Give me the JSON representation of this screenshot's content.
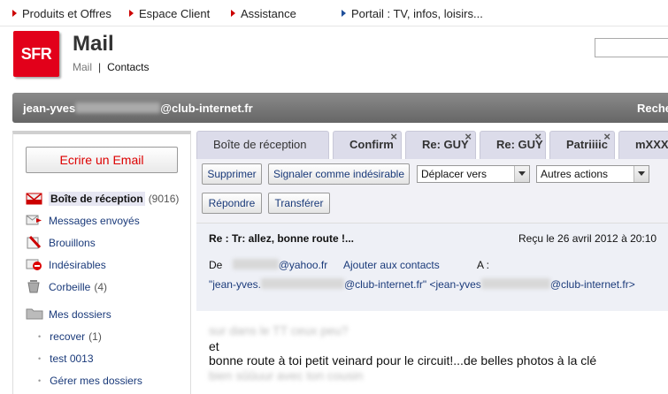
{
  "topnav": {
    "items": [
      {
        "label": "Produits et Offres"
      },
      {
        "label": "Espace Client"
      },
      {
        "label": "Assistance"
      },
      {
        "label": "Portail : TV, infos, loisirs..."
      }
    ]
  },
  "header": {
    "logo_text": "SFR",
    "title": "Mail",
    "sub_mail": "Mail",
    "sub_sep": "|",
    "sub_contacts": "Contacts"
  },
  "account": {
    "email_prefix": "jean-yves",
    "email_domain": "@club-internet.fr",
    "search_label": "Reche"
  },
  "sidebar": {
    "compose_label": "Ecrire un Email",
    "folders": [
      {
        "label": "Boîte de réception",
        "count": "(9016)",
        "icon": "inbox-icon"
      },
      {
        "label": "Messages envoyés",
        "count": "",
        "icon": "sent-icon"
      },
      {
        "label": "Brouillons",
        "count": "",
        "icon": "drafts-icon"
      },
      {
        "label": "Indésirables",
        "count": "",
        "icon": "spam-icon"
      },
      {
        "label": "Corbeille",
        "count": "(4)",
        "icon": "trash-icon"
      },
      {
        "label": "Mes dossiers",
        "count": "",
        "icon": "folder-icon"
      }
    ],
    "subfolders": [
      {
        "label": "recover",
        "count": "(1)"
      },
      {
        "label": "test 0013",
        "count": ""
      },
      {
        "label": "Gérer mes dossiers",
        "count": ""
      }
    ]
  },
  "tabs": [
    {
      "label": "Boîte de réception",
      "closable": false
    },
    {
      "label": "Confirm",
      "closable": true
    },
    {
      "label": "Re: GUY",
      "closable": true
    },
    {
      "label": "Re: GUY",
      "closable": true
    },
    {
      "label": "Patriiiic",
      "closable": true
    },
    {
      "label": "mXXXX",
      "closable": false
    }
  ],
  "toolbar": {
    "delete_label": "Supprimer",
    "spam_label": "Signaler comme indésirable",
    "move_select": "Déplacer vers",
    "actions_select": "Autres actions",
    "reply_label": "Répondre",
    "forward_label": "Transférer"
  },
  "message": {
    "subject": "Re : Tr: allez, bonne route !...",
    "received": "Reçu le 26 avril 2012 à 20:10",
    "from_label": "De",
    "from_domain": "@yahoo.fr",
    "add_contact": "Ajouter aux contacts",
    "to_label": "A :",
    "to_name_prefix": "\"jean-yves.",
    "to_name_suffix": "@club-internet.fr\"",
    "to_addr_prefix": "<jean-yves",
    "to_addr_suffix": "@club-internet.fr>",
    "body_line1": "sur dans le TT ceux peu?",
    "body_line2": "et",
    "body_line3": "bonne route à toi petit veinard pour le circuit!...de belles photos à la clé",
    "body_line4": "bien sûûuur avec ton cousin"
  }
}
